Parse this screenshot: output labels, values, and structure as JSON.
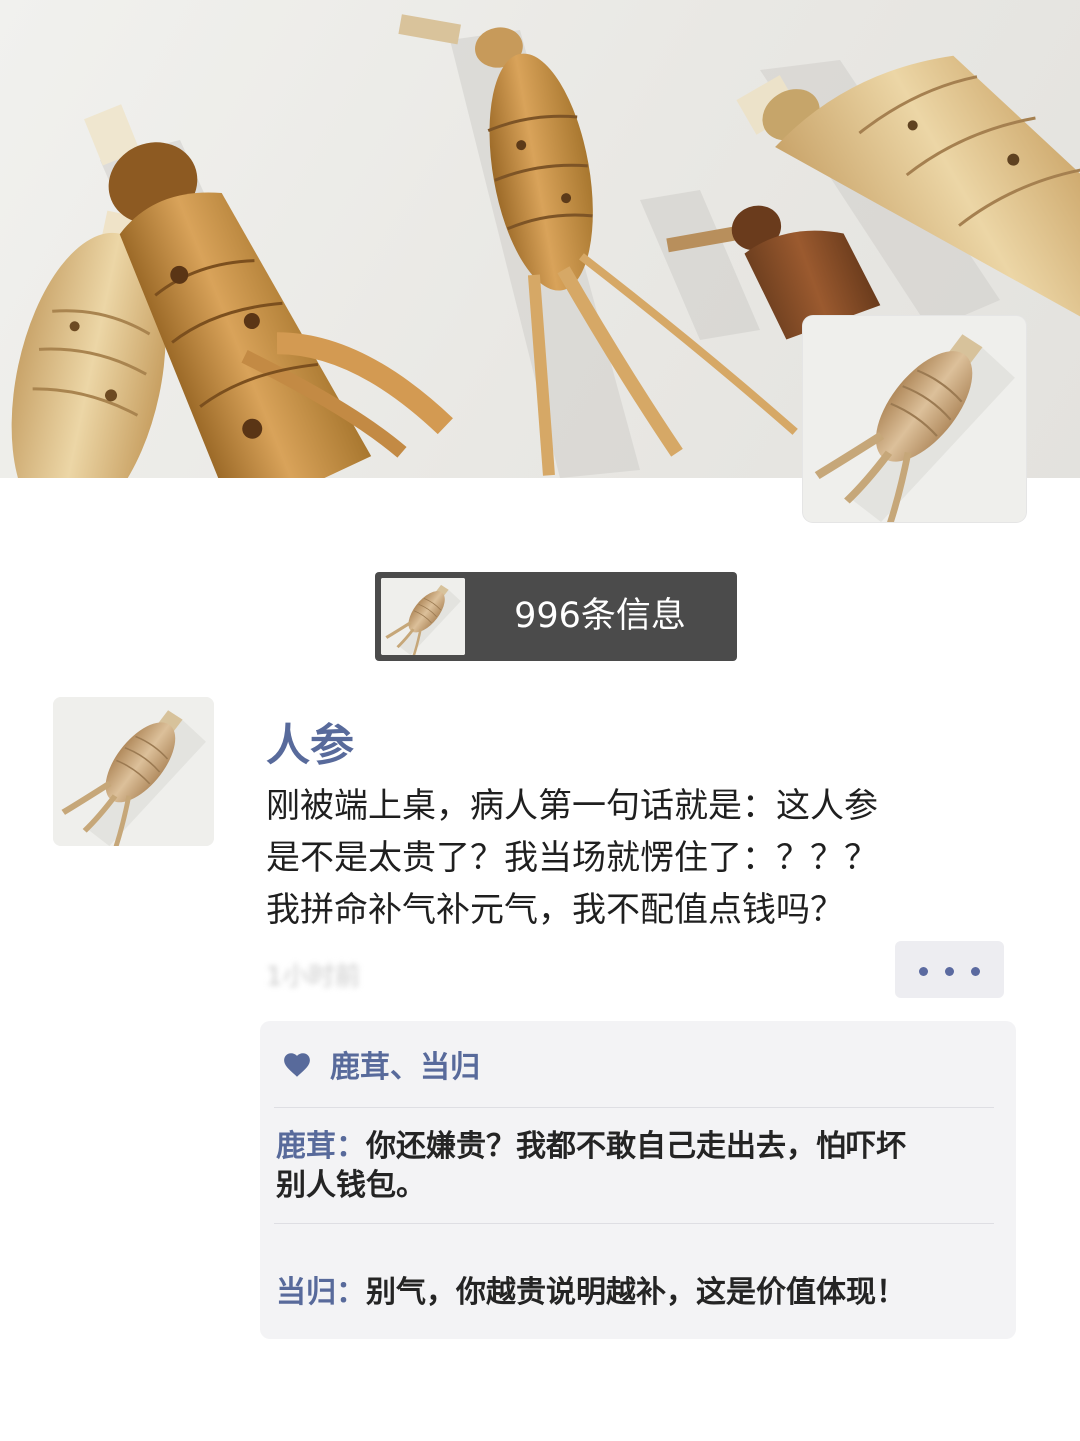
{
  "notification": {
    "count_text": "996条信息"
  },
  "post": {
    "author": "人参",
    "lines": [
      "刚被端上桌，病人第一句话就是：这人参",
      "是不是太贵了？我当场就愣住了：？？？",
      "我拼命补气补元气，我不配值点钱吗？"
    ],
    "time": "1小时前",
    "more_icon": "more-dots-icon"
  },
  "likes": {
    "icon": "heart-icon",
    "names": "鹿茸、当归"
  },
  "comments": [
    {
      "author": "鹿茸：",
      "line1": "你还嫌贵？我都不敢自己走出去，怕吓坏",
      "line2": "别人钱包。"
    },
    {
      "author": "当归：",
      "line1": "别气，你越贵说明越补，这是价值体现！",
      "line2": ""
    }
  ],
  "colors": {
    "accent": "#586a9b",
    "pill_bg": "#4b4b4b",
    "comment_bg": "#f3f3f5"
  }
}
